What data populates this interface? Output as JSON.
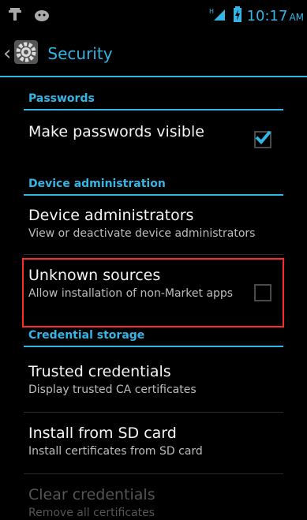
{
  "status_bar": {
    "time": "10:17",
    "ampm": "AM",
    "left_icons": [
      "usb-icon",
      "android-icon"
    ],
    "right_icons": [
      "signal-icon",
      "battery-icon"
    ]
  },
  "action_bar": {
    "title": "Security",
    "icon": "gear-icon"
  },
  "sections": {
    "passwords": {
      "header": "Passwords",
      "items": [
        {
          "title": "Make passwords visible",
          "checked": true
        }
      ]
    },
    "device_admin": {
      "header": "Device administration",
      "items": [
        {
          "title": "Device administrators",
          "subtitle": "View or deactivate device administrators"
        },
        {
          "title": "Unknown sources",
          "subtitle": "Allow installation of non-Market apps",
          "checked": false
        }
      ]
    },
    "credential_storage": {
      "header": "Credential storage",
      "items": [
        {
          "title": "Trusted credentials",
          "subtitle": "Display trusted CA certificates"
        },
        {
          "title": "Install from SD card",
          "subtitle": "Install certificates from SD card"
        },
        {
          "title": "Clear credentials",
          "subtitle": "Remove all certificates",
          "disabled": true
        }
      ]
    }
  },
  "colors": {
    "accent": "#33b5e5",
    "highlight_box": "#ff2a2a",
    "background": "#000000"
  }
}
